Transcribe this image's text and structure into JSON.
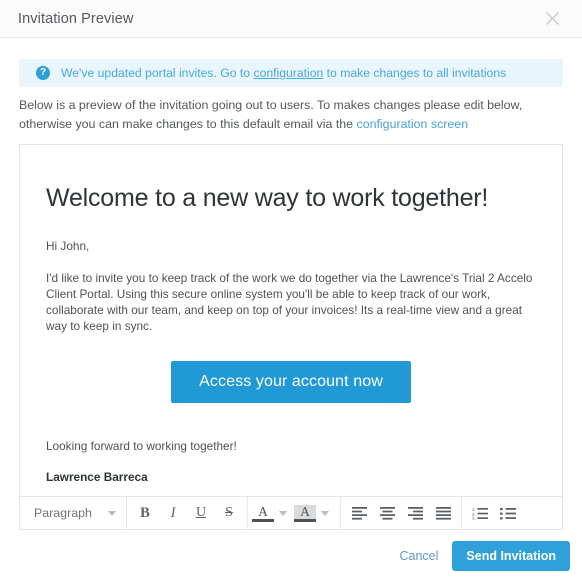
{
  "header": {
    "title": "Invitation Preview",
    "close_icon": "close-icon"
  },
  "banner": {
    "icon": "question-mark-icon",
    "text_before_link": "We've updated portal invites. Go to ",
    "link": "configuration",
    "text_after_link": " to make changes to all invitations",
    "background": "#e9f6fd",
    "accent": "#2c9fd7"
  },
  "description": {
    "text_before_link": "Below is a preview of the invitation going out to users. To makes changes please edit below, otherwise you can make changes to this default email via the ",
    "link": "configuration screen"
  },
  "email": {
    "heading": "Welcome to a new way to work together!",
    "greeting": "Hi John,",
    "paragraph": "I'd like to invite you to keep track of the work we do together via the Lawrence's Trial 2 Accelo Client Portal. Using this secure online system you'll be able to keep track of our work, collaborate with our team, and keep on top of your invoices! Its a real-time view and a great way to keep in sync.",
    "cta_label": "Access your account now",
    "cta_color": "#2199d4",
    "closing": "Looking forward to working together!",
    "signature": "Lawrence Barreca"
  },
  "toolbar": {
    "format_select": {
      "value": "Paragraph",
      "icon": "chevron-down-icon"
    },
    "buttons": [
      {
        "name": "bold-button",
        "icon": "bold-icon",
        "label": "B"
      },
      {
        "name": "italic-button",
        "icon": "italic-icon",
        "label": "I"
      },
      {
        "name": "underline-button",
        "icon": "underline-icon",
        "label": "U"
      },
      {
        "name": "strikethrough-button",
        "icon": "strikethrough-icon",
        "label": "S"
      },
      {
        "name": "text-color-button",
        "icon": "text-color-icon",
        "label": "A"
      },
      {
        "name": "background-color-button",
        "icon": "background-color-icon",
        "label": "A"
      },
      {
        "name": "align-left-button",
        "icon": "align-left-icon",
        "label": ""
      },
      {
        "name": "align-center-button",
        "icon": "align-center-icon",
        "label": ""
      },
      {
        "name": "align-right-button",
        "icon": "align-right-icon",
        "label": ""
      },
      {
        "name": "align-justify-button",
        "icon": "align-justify-icon",
        "label": ""
      },
      {
        "name": "ordered-list-button",
        "icon": "numbered-list-icon",
        "label": ""
      },
      {
        "name": "unordered-list-button",
        "icon": "bullet-list-icon",
        "label": ""
      }
    ]
  },
  "footer": {
    "cancel_label": "Cancel",
    "send_label": "Send Invitation",
    "send_color": "#2fa1d8"
  }
}
